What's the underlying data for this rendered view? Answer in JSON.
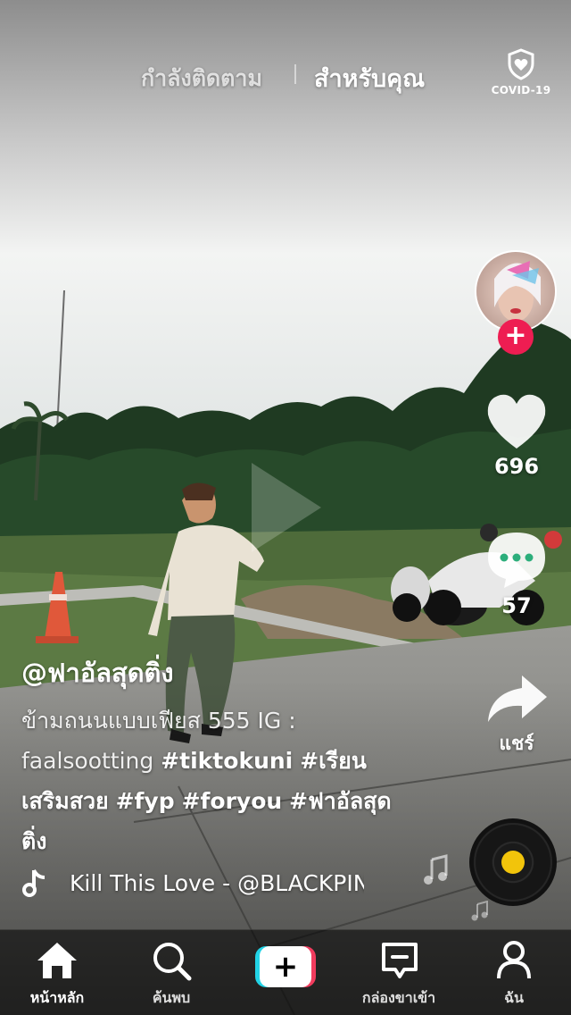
{
  "header": {
    "tab_following": "กำลังติดตาม",
    "tab_foryou": "สำหรับคุณ",
    "covid_label": "COVID-19"
  },
  "rail": {
    "likes": "696",
    "comments": "57",
    "share_label": "แชร์"
  },
  "post": {
    "username": "@ฟาอัลสุดติ่ง",
    "caption_plain": "ข้ามถนนแบบเฟียส 555 IG : faalsootting ",
    "hashtags": [
      "#tiktokuni",
      "#เรียนเสริมสวย",
      "#fyp",
      "#foryou",
      "#ฟาอัลสุดติ่ง"
    ],
    "music": "Kill This Love - @BLACKPINK"
  },
  "nav": {
    "home": "หน้าหลัก",
    "discover": "ค้นพบ",
    "inbox": "กล่องขาเข้า",
    "profile": "ฉัน"
  },
  "colors": {
    "accent_red": "#ee1d52",
    "accent_cyan": "#22d3e6",
    "disc_label": "#f2c40b"
  }
}
